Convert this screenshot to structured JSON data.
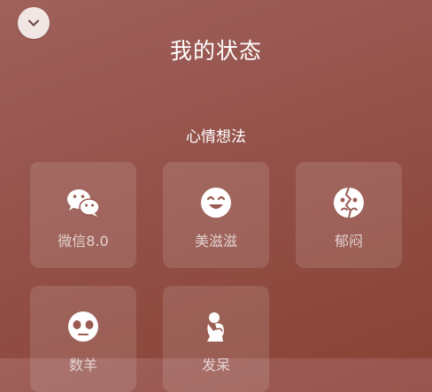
{
  "header": {
    "title": "我的状态",
    "close_icon": "chevron-down-icon"
  },
  "section": {
    "title": "心情想法"
  },
  "tiles": [
    {
      "label": "微信8.0",
      "icon": "wechat-icon"
    },
    {
      "label": "美滋滋",
      "icon": "smile-face-icon"
    },
    {
      "label": "郁闷",
      "icon": "gloomy-face-icon"
    },
    {
      "label": "数羊",
      "icon": "sleepy-face-icon"
    },
    {
      "label": "发呆",
      "icon": "thinking-figure-icon"
    }
  ],
  "colors": {
    "bg_top": "#a0615b",
    "bg_bottom": "#8a4436",
    "tile_bg": "rgba(255,255,255,0.12)",
    "close_bg": "#f1e6e3"
  }
}
